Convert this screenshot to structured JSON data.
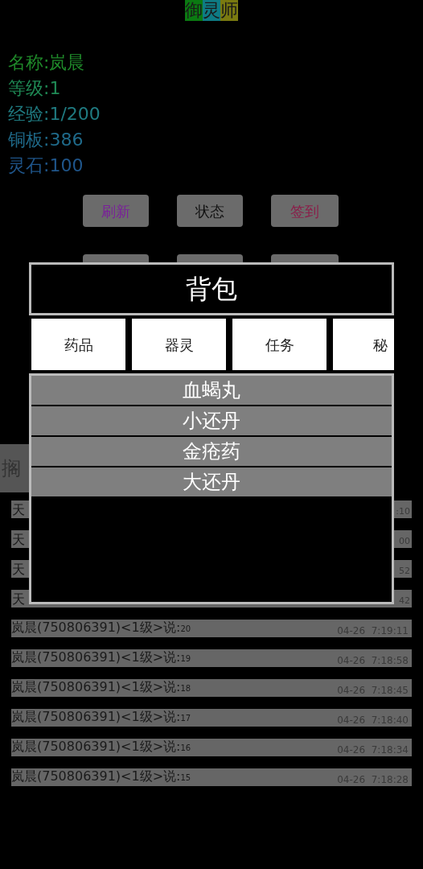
{
  "title": [
    {
      "char": "御",
      "color": "#0b7a12"
    },
    {
      "char": "灵",
      "color": "#0e7b84"
    },
    {
      "char": "师",
      "color": "#7a7a10"
    }
  ],
  "stats": [
    {
      "text": "名称:岚晨",
      "color": "#1f8a2a"
    },
    {
      "text": "等级:1",
      "color": "#1f8a55"
    },
    {
      "text": "经验:1/200",
      "color": "#1f7a80"
    },
    {
      "text": "铜板:386",
      "color": "#1f6a8a"
    },
    {
      "text": "灵石:100",
      "color": "#1f558a"
    }
  ],
  "buttons": [
    {
      "label": "刷新"
    },
    {
      "label": "状态"
    },
    {
      "label": "签到"
    },
    {
      "kind": "covered"
    },
    {
      "kind": "covered"
    },
    {
      "kind": "covered"
    }
  ],
  "input": {
    "placeholder": "搁"
  },
  "chat": [
    {
      "kind": "partial",
      "sender": "天",
      "time": ":10"
    },
    {
      "kind": "partial",
      "sender": "天",
      "time": "00"
    },
    {
      "kind": "partial",
      "sender": "天",
      "time": "52"
    },
    {
      "kind": "partial",
      "sender": "天",
      "time": "42"
    },
    {
      "kind": "full",
      "sender": "岚晨(750806391)<1级>说:",
      "message": "20",
      "time": "04-26  7:19:11"
    },
    {
      "kind": "full",
      "sender": "岚晨(750806391)<1级>说:",
      "message": "19",
      "time": "04-26  7:18:58"
    },
    {
      "kind": "full",
      "sender": "岚晨(750806391)<1级>说:",
      "message": "18",
      "time": "04-26  7:18:45"
    },
    {
      "kind": "full",
      "sender": "岚晨(750806391)<1级>说:",
      "message": "17",
      "time": "04-26  7:18:40"
    },
    {
      "kind": "full",
      "sender": "岚晨(750806391)<1级>说:",
      "message": "16",
      "time": "04-26  7:18:34"
    },
    {
      "kind": "full",
      "sender": "岚晨(750806391)<1级>说:",
      "message": "15",
      "time": "04-26  7:18:28"
    }
  ],
  "dialog": {
    "title": "背包",
    "tabs": [
      {
        "label": "药品"
      },
      {
        "label": "器灵"
      },
      {
        "label": "任务"
      },
      {
        "label": "秘"
      }
    ],
    "items": [
      "血蝎丸",
      "小还丹",
      "金疮药",
      "大还丹"
    ]
  }
}
